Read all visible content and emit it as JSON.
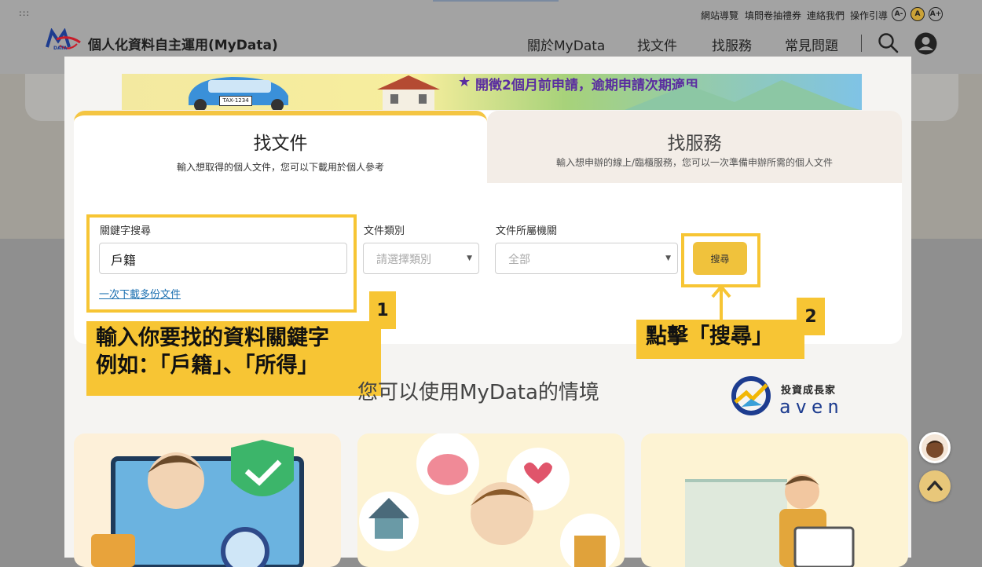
{
  "header": {
    "menu_icon": "dots-icon",
    "logo_text": "DATA",
    "site_title": "個人化資料自主運用(MyData)",
    "utility_links": [
      "網站導覽",
      "填問卷抽禮券",
      "連絡我們",
      "操作引導"
    ],
    "font_sizes": [
      "A-",
      "A",
      "A+"
    ],
    "nav": [
      "關於MyData",
      "找文件",
      "找服務",
      "常見問題"
    ],
    "search_icon": "search-icon",
    "user_icon": "user-icon"
  },
  "banner": {
    "text": "開徵2個月前申請，逾期申請次期適用",
    "plate": "TAX-1234"
  },
  "tabs": [
    {
      "title": "找文件",
      "subtitle": "輸入想取得的個人文件，您可以下載用於個人參考"
    },
    {
      "title": "找服務",
      "subtitle": "輸入想申辦的線上/臨櫃服務，您可以一次準備申辦所需的個人文件"
    }
  ],
  "search": {
    "keyword_label": "關鍵字搜尋",
    "keyword_value": "戶籍",
    "category_label": "文件類別",
    "category_placeholder": "請選擇類別",
    "agency_label": "文件所屬機關",
    "agency_value": "全部",
    "button_label": "搜尋",
    "multi_download_link": "一次下載多份文件"
  },
  "annotations": {
    "step1_number": "1",
    "step1_line1": "輸入你要找的資料關鍵字",
    "step1_line2": "例如：「戶籍」、「所得」",
    "step2_number": "2",
    "step2_text": "點擊「搜尋」"
  },
  "section": {
    "title": "您可以使用MyData的情境"
  },
  "watermark": {
    "cn": "投資成長家",
    "en": "aven"
  },
  "colors": {
    "accent_yellow": "#f7c534",
    "button_yellow": "#f0c23c",
    "link_blue": "#1a6fb0",
    "brand_navy": "#1d3c8f"
  }
}
